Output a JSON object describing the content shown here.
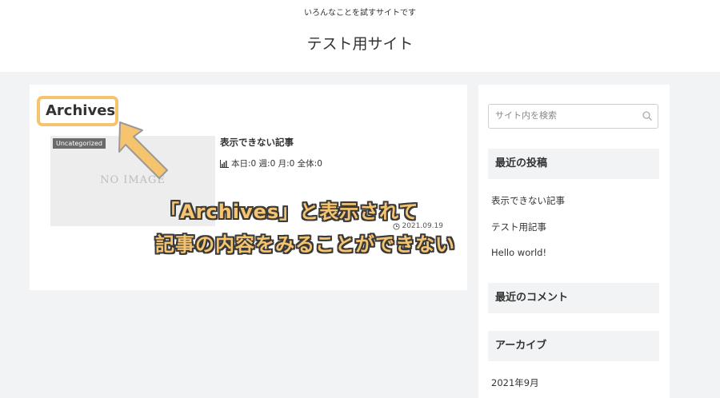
{
  "header": {
    "tagline": "いろんなことを試すサイトです",
    "site_title": "テスト用サイト"
  },
  "main": {
    "archive_title": "Archives",
    "entry": {
      "category": "Uncategorized",
      "thumbnail_text": "NO IMAGE",
      "title": "表示できない記事",
      "pv_text": "本日:0  週:0  月:0  全体:0",
      "date": "2021.09.19"
    }
  },
  "sidebar": {
    "search_placeholder": "サイト内を検索",
    "recent_posts": {
      "title": "最近の投稿",
      "items": [
        "表示できない記事",
        "テスト用記事",
        "Hello world!"
      ]
    },
    "recent_comments": {
      "title": "最近のコメント"
    },
    "archives": {
      "title": "アーカイブ",
      "items": [
        "2021年9月"
      ]
    }
  },
  "annotation": {
    "line1": "「Archives」と表示されて",
    "line2": "記事の内容をみることができない",
    "color": "#f6c46f"
  }
}
